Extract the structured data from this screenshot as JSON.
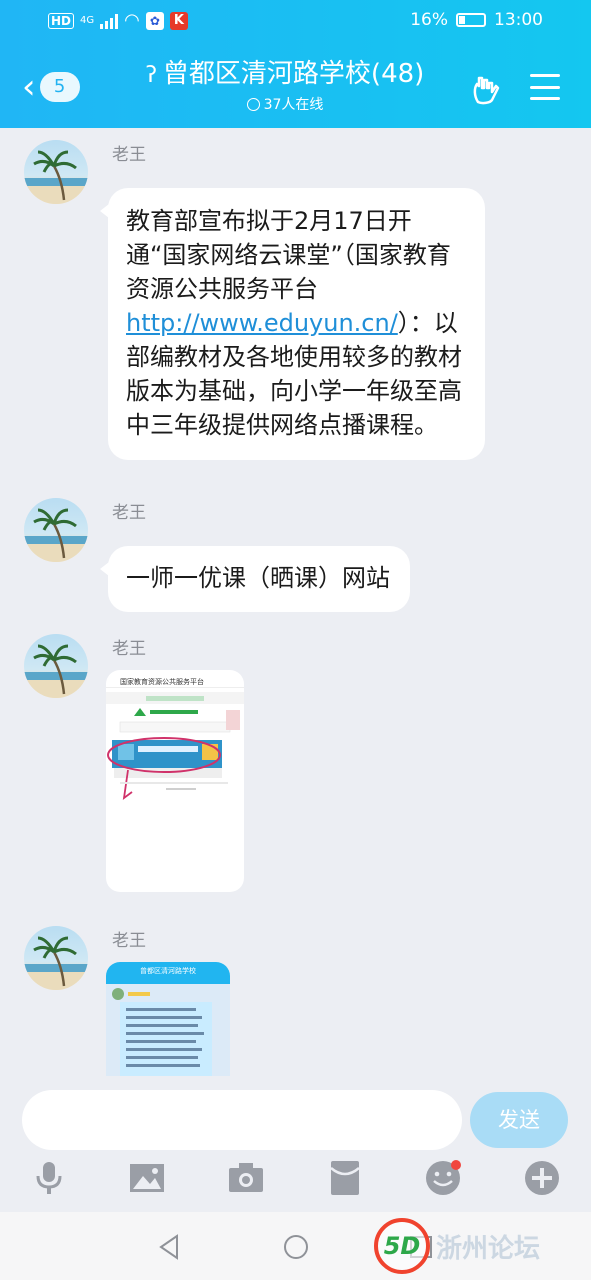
{
  "status_bar": {
    "hd": "HD",
    "network": "4G",
    "battery_pct": "16%",
    "time": "13:00"
  },
  "title_bar": {
    "back_count": "5",
    "title": "曾都区清河路学校(48)",
    "online": "37人在线",
    "icons": [
      "back-chevron-icon",
      "hearing-icon",
      "hand-gesture-icon",
      "menu-icon"
    ]
  },
  "messages": [
    {
      "sender": "老王",
      "type": "text",
      "text_before": "教育部宣布拟于2月17日开通“国家网络云课堂”（国家教育资源公共服务平台",
      "link": "http://www.eduyun.cn/",
      "text_after": "）：以部编教材及各地使用较多的教材版本为基础，向小学一年级至高中三年级提供网络点播课程。"
    },
    {
      "sender": "老王",
      "type": "text",
      "text": "一师一优课（晒课）网站"
    },
    {
      "sender": "老王",
      "type": "image",
      "image_caption": "国家教育资源公共服务平台"
    },
    {
      "sender": "老王",
      "type": "image",
      "image_caption": "曾都区清河路学校"
    }
  ],
  "input": {
    "placeholder": "",
    "send_label": "发送"
  },
  "toolbar_icons": [
    "microphone-icon",
    "image-icon",
    "camera-icon",
    "red-packet-icon",
    "emoji-icon",
    "plus-icon"
  ],
  "nav_icons": [
    "nav-back-icon",
    "nav-home-icon",
    "nav-recents-icon"
  ],
  "watermark": {
    "logo_text": "5D",
    "text": "浙州论坛"
  },
  "colors": {
    "header_blue": "#1ab9f3",
    "chat_bg": "#eceef3",
    "link_blue": "#1f8fd8",
    "send_button": "#a9dcf6",
    "badge_red": "#f0473f"
  }
}
